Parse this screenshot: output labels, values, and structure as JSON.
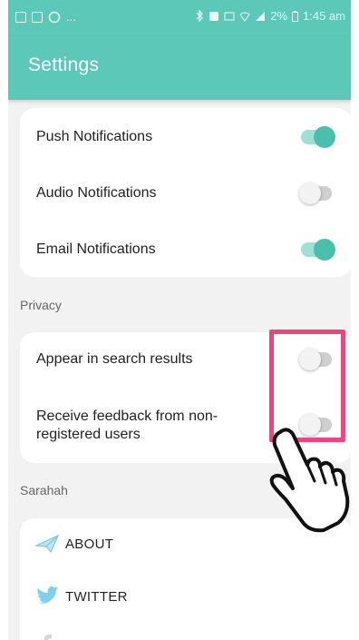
{
  "status_bar": {
    "left_icons": [
      "image-icon",
      "gallery-icon",
      "whatsapp-icon"
    ],
    "ellipsis": "...",
    "battery_percent": "2%",
    "time": "1:45 am"
  },
  "app_bar": {
    "title": "Settings"
  },
  "notifications": {
    "items": [
      {
        "label": "Push Notifications",
        "enabled": true
      },
      {
        "label": "Audio Notifications",
        "enabled": false
      },
      {
        "label": "Email Notifications",
        "enabled": true
      }
    ]
  },
  "privacy": {
    "section_label": "Privacy",
    "items": [
      {
        "label": "Appear in search results",
        "enabled": false
      },
      {
        "label": "Receive feedback from non-registered users",
        "line1": "Receive feedback from non-",
        "line2": "registered users",
        "enabled": false
      }
    ]
  },
  "sarahah": {
    "section_label": "Sarahah",
    "links": [
      {
        "label": "ABOUT",
        "icon": "paper-plane-icon"
      },
      {
        "label": "TWITTER",
        "icon": "twitter-icon"
      }
    ]
  },
  "colors": {
    "accent": "#5cc8b8",
    "toggle_on": "#4bbfae",
    "highlight": "#f0457a"
  }
}
